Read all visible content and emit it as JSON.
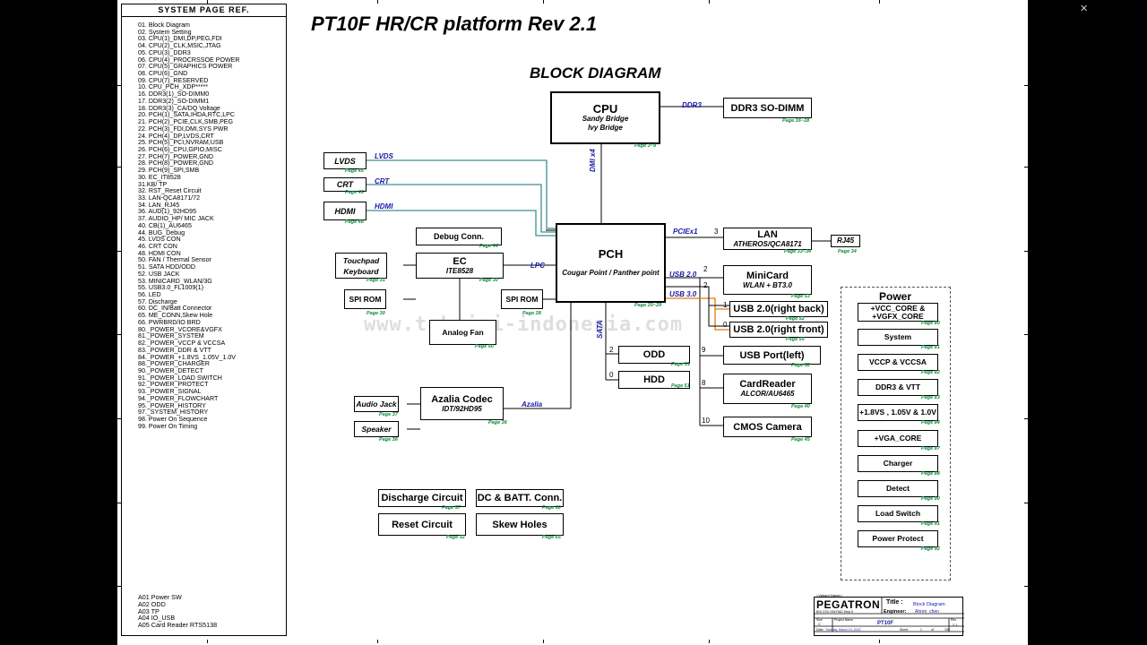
{
  "toc": {
    "title": "SYSTEM PAGE REF.",
    "items": [
      "01. Block Diagram",
      "02. System Setting",
      "03. CPU(1)_DMI,DP,PEG,FDI",
      "04. CPU(2)_CLK,MSIC,JTAG",
      "05. CPU(3)_DDR3",
      "06. CPU(4)_PROCRSSOE POWER",
      "07. CPU(5)_GRAPHICS POWER",
      "08. CPU(6)_GND",
      "09. CPU(7)_RESERVED",
      "10. CPU_PCH_XDP*****",
      "16. DDR3(1)_SO-DIMM0",
      "17. DDR3(2)_SO-DIMM1",
      "18. DDR3(3)_CA/DQ Voltage",
      "20. PCH(1)_SATA,IHDA,RTC,LPC",
      "21. PCH(2)_PCIE,CLK,SMB,PEG",
      "22. PCH(3)_FDI,DMI,SYS PWR",
      "24. PCH(4)_DP,LVDS,CRT",
      "25. PCH(5)_PCI,NVRAM,USB",
      "26. PCH(6)_CPU,GPIO,MISC",
      "27. PCH(7)_POWER,GND",
      "28. PCH(8)_POWER,GND",
      "29. PCH(9)_SPI,SMB",
      "30. EC_IT8528",
      "31.KB/ TP",
      "32. RST_Reset Circuit",
      "33. LAN-QCA8171/72",
      "34. LAN_RJ45",
      "36. AUD(1)_92HD95",
      "37. AUDIO_HP/ MIC JACK",
      "40. CB(1)_AU6465",
      "44. BUG_Debug",
      "45. LVDS CON",
      "46. CRT CON",
      "48. HDMI CON",
      "50. FAN / Thermal Sensor",
      "51. SATA HDD/ODD",
      "52. USB JACK",
      "53. MINICARD_WLAN/3G",
      "55. USB3.0_FL1009(1)",
      "56. LED",
      "57. Discharge",
      "60. DC_IN/Batt Connector",
      "65. ME_CONN,Skew Hole",
      "66. PWRBRD/IO BRD",
      "80._POWER_VCORE&VGFX",
      "81._POWER_SYSTEM",
      "82._POWER_VCCP & VCCSA",
      "83._POWER_DDR & VTT",
      "84._POWER_+1.8VS_1.05V_1.0V",
      "88._POWER_CHARGER",
      "90._POWER_DETECT",
      "91._POWER_LOAD SWITCH",
      "92._POWER_PROTECT",
      "93._POWER_SIGNAL",
      "94._POWER_FLOWCHART",
      "95._POWER_HISTORY",
      "97._SYSTEM_HISTORY",
      "98. Power On Sequence",
      "99. Power On Timing"
    ],
    "items2": [
      "A01 Power SW",
      "A02 ODD",
      "A03 TP",
      "A04 IO_USB",
      "A05 Card Reader RTS5138"
    ]
  },
  "title": "PT10F HR/CR platform Rev 2.1",
  "block_title": "BLOCK DIAGRAM",
  "watermark": "www.teknisi-indonesia.com",
  "blocks": {
    "cpu": {
      "name": "CPU",
      "sub1": "Sandy Bridge",
      "sub2": "Ivy Bridge",
      "page": "Page 3~9"
    },
    "ddr3": {
      "name": "DDR3 SO-DIMM",
      "page": "Page 16~18"
    },
    "pch": {
      "name": "PCH",
      "sub": "Cougar Point / Panther point",
      "page": "Page 20~29"
    },
    "lvds": {
      "name": "LVDS",
      "page": "Page 45"
    },
    "crt": {
      "name": "CRT",
      "page": "Page 46"
    },
    "hdmi": {
      "name": "HDMI",
      "page": "Page 48"
    },
    "debug": {
      "name": "Debug Conn.",
      "page": "Page 44"
    },
    "touchpad": {
      "name1": "Touchpad",
      "name2": "Keyboard",
      "page": "Page 31"
    },
    "ec": {
      "name": "EC",
      "sub": "ITE8528",
      "page": "Page 30"
    },
    "spirom1": {
      "name": "SPI ROM",
      "page": "Page 30"
    },
    "spirom2": {
      "name": "SPI ROM",
      "page": "Page 28"
    },
    "fan": {
      "name": "Analog Fan",
      "page": "Page 50"
    },
    "lan": {
      "name": "LAN",
      "sub": "ATHEROS/QCA8171",
      "page": "Page 33~34"
    },
    "rj45": {
      "name": "RJ45",
      "page": "Page 34"
    },
    "minicard": {
      "name": "MiniCard",
      "sub": "WLAN + BT3.0",
      "page": "Page 53"
    },
    "usbback": {
      "name": "USB 2.0(right back)",
      "page": "Page 52"
    },
    "usbfront": {
      "name": "USB 2.0(right front)",
      "page": "Page 55"
    },
    "odd": {
      "name": "ODD",
      "page": "Page 51"
    },
    "hdd": {
      "name": "HDD",
      "page": "Page 51"
    },
    "usbport": {
      "name": "USB Port(left)",
      "page": "Page 52"
    },
    "cardreader": {
      "name": "CardReader",
      "sub": "ALCOR/AU6465",
      "page": "Page 40"
    },
    "cmos": {
      "name": "CMOS Camera",
      "page": "Page 45"
    },
    "azalia": {
      "name": "Azalia Codec",
      "sub": "IDT/92HD95",
      "page": "Page 36"
    },
    "audiojack": {
      "name": "Audio Jack",
      "page": "Page 37"
    },
    "speaker": {
      "name": "Speaker",
      "page": "Page 36"
    },
    "discharge": {
      "name": "Discharge Circuit",
      "page": "Page 57"
    },
    "dcbatt": {
      "name": "DC & BATT. Conn.",
      "page": "Page 60"
    },
    "reset": {
      "name": "Reset Circuit",
      "page": "Page 32"
    },
    "skew": {
      "name": "Skew Holes",
      "page": "Page 65"
    }
  },
  "buses": {
    "ddr3": "DDR3",
    "dmi": "DMI x4",
    "lvds": "LVDS",
    "crt": "CRT",
    "hdmi": "HDMI",
    "lpc": "LPC",
    "pciex1": "PCIEx1",
    "usb20": "USB 2.0",
    "usb30": "USB 3.0",
    "sata": "SATA",
    "azalia": "Azalia"
  },
  "ports": {
    "lan": "3",
    "minicard_pcie": "2",
    "minicard_usb": "2",
    "usbback": "1",
    "usbfront": "0",
    "odd": "2",
    "hdd": "0",
    "usbport": "9",
    "cardreader": "8",
    "cmos": "10"
  },
  "power": {
    "title": "Power",
    "items": [
      {
        "name1": "+VCC_CORE &",
        "name2": "+VGFX_CORE",
        "page": "Page 80"
      },
      {
        "name1": "System",
        "name2": "",
        "page": "Page 81"
      },
      {
        "name1": "VCCP & VCCSA",
        "name2": "",
        "page": "Page 82"
      },
      {
        "name1": "DDR3 & VTT",
        "name2": "",
        "page": "Page 83"
      },
      {
        "name1": "+1.8VS , 1.05V & 1.0V",
        "name2": "",
        "page": "Page 84"
      },
      {
        "name1": "+VGA_CORE",
        "name2": "",
        "page": "Page 87"
      },
      {
        "name1": "Charger",
        "name2": "",
        "page": "Page 88"
      },
      {
        "name1": "Detect",
        "name2": "",
        "page": "Page 90"
      },
      {
        "name1": "Load Switch",
        "name2": "",
        "page": "Page 91"
      },
      {
        "name1": "Power Protect",
        "name2": "",
        "page": "Page 92"
      }
    ]
  },
  "titleblock": {
    "vendor_label": "<Variant Name>",
    "logo": "PEGATRON",
    "title_label": "Title :",
    "title_value": "Block Diagram",
    "engineer_label": "Engineer:",
    "engineer_value": "Ahren_chen",
    "dept": "BGI CSC-HW R&D Dept.5",
    "size_label": "Size",
    "size_value": "C",
    "project_label": "Project Name",
    "project_value": "PT10F",
    "rev_label": "Rev",
    "rev_value": "2.1",
    "date_label": "Date:",
    "date_value": "Tuesday, March 19, 2013",
    "sheet_label": "Sheet",
    "sheet_value": "1",
    "of_label": "of",
    "of_value": "100"
  },
  "colors": {
    "bus_blue": "#1a1aa8",
    "page_green": "#0a8a3a",
    "video_teal": "#3f8f8f",
    "usb3_orange": "#e07a10"
  }
}
